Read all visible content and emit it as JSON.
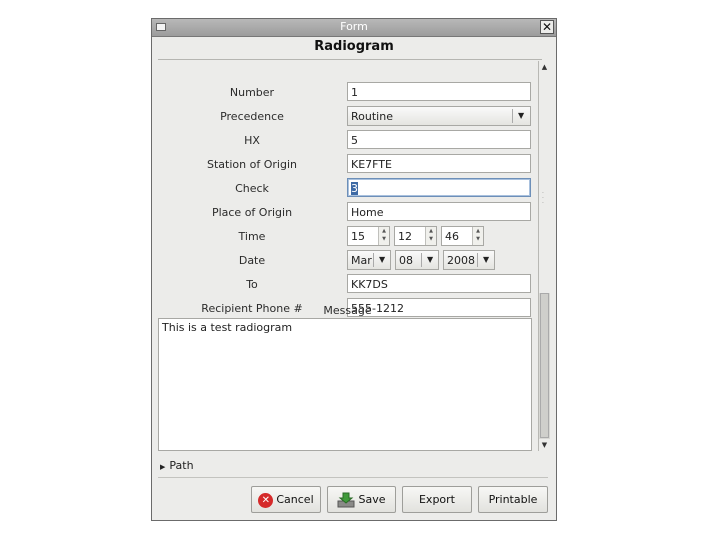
{
  "window": {
    "title": "Form",
    "close_symbol": "✕"
  },
  "form": {
    "heading": "Radiogram",
    "fields": [
      {
        "label": "Number",
        "value": "1"
      },
      {
        "label": "Precedence",
        "value": "Routine"
      },
      {
        "label": "HX",
        "value": "5"
      },
      {
        "label": "Station of Origin",
        "value": "KE7FTE"
      },
      {
        "label": "Check",
        "value": "3"
      },
      {
        "label": "Place of Origin",
        "value": "Home"
      },
      {
        "label": "Time",
        "hour": "15",
        "minute": "12",
        "second": "46"
      },
      {
        "label": "Date",
        "month": "Mar",
        "day": "08",
        "year": "2008"
      },
      {
        "label": "To",
        "value": "KK7DS"
      },
      {
        "label": "Recipient Phone #",
        "value": "555-1212"
      }
    ],
    "message_label": "Message",
    "message": "This is a test radiogram",
    "path_label": "Path"
  },
  "buttons": {
    "cancel": "Cancel",
    "save": "Save",
    "export": "Export",
    "printable": "Printable"
  },
  "colors": {
    "cancel_icon": "#d52a2a",
    "save_icon": "#3f9a3a",
    "focus": "#3e6aa5"
  }
}
